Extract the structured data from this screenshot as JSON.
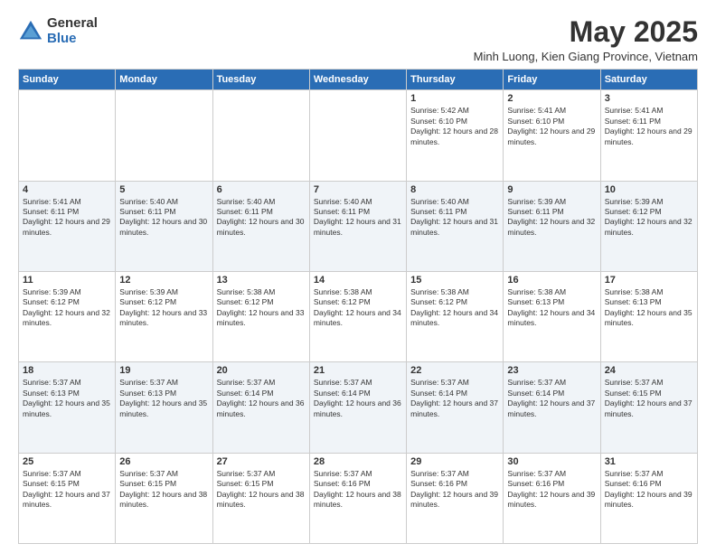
{
  "logo": {
    "general": "General",
    "blue": "Blue"
  },
  "header": {
    "month_title": "May 2025",
    "location": "Minh Luong, Kien Giang Province, Vietnam"
  },
  "days_of_week": [
    "Sunday",
    "Monday",
    "Tuesday",
    "Wednesday",
    "Thursday",
    "Friday",
    "Saturday"
  ],
  "weeks": [
    [
      {
        "day": "",
        "sunrise": "",
        "sunset": "",
        "daylight": ""
      },
      {
        "day": "",
        "sunrise": "",
        "sunset": "",
        "daylight": ""
      },
      {
        "day": "",
        "sunrise": "",
        "sunset": "",
        "daylight": ""
      },
      {
        "day": "",
        "sunrise": "",
        "sunset": "",
        "daylight": ""
      },
      {
        "day": "1",
        "sunrise": "Sunrise: 5:42 AM",
        "sunset": "Sunset: 6:10 PM",
        "daylight": "Daylight: 12 hours and 28 minutes."
      },
      {
        "day": "2",
        "sunrise": "Sunrise: 5:41 AM",
        "sunset": "Sunset: 6:10 PM",
        "daylight": "Daylight: 12 hours and 29 minutes."
      },
      {
        "day": "3",
        "sunrise": "Sunrise: 5:41 AM",
        "sunset": "Sunset: 6:11 PM",
        "daylight": "Daylight: 12 hours and 29 minutes."
      }
    ],
    [
      {
        "day": "4",
        "sunrise": "Sunrise: 5:41 AM",
        "sunset": "Sunset: 6:11 PM",
        "daylight": "Daylight: 12 hours and 29 minutes."
      },
      {
        "day": "5",
        "sunrise": "Sunrise: 5:40 AM",
        "sunset": "Sunset: 6:11 PM",
        "daylight": "Daylight: 12 hours and 30 minutes."
      },
      {
        "day": "6",
        "sunrise": "Sunrise: 5:40 AM",
        "sunset": "Sunset: 6:11 PM",
        "daylight": "Daylight: 12 hours and 30 minutes."
      },
      {
        "day": "7",
        "sunrise": "Sunrise: 5:40 AM",
        "sunset": "Sunset: 6:11 PM",
        "daylight": "Daylight: 12 hours and 31 minutes."
      },
      {
        "day": "8",
        "sunrise": "Sunrise: 5:40 AM",
        "sunset": "Sunset: 6:11 PM",
        "daylight": "Daylight: 12 hours and 31 minutes."
      },
      {
        "day": "9",
        "sunrise": "Sunrise: 5:39 AM",
        "sunset": "Sunset: 6:11 PM",
        "daylight": "Daylight: 12 hours and 32 minutes."
      },
      {
        "day": "10",
        "sunrise": "Sunrise: 5:39 AM",
        "sunset": "Sunset: 6:12 PM",
        "daylight": "Daylight: 12 hours and 32 minutes."
      }
    ],
    [
      {
        "day": "11",
        "sunrise": "Sunrise: 5:39 AM",
        "sunset": "Sunset: 6:12 PM",
        "daylight": "Daylight: 12 hours and 32 minutes."
      },
      {
        "day": "12",
        "sunrise": "Sunrise: 5:39 AM",
        "sunset": "Sunset: 6:12 PM",
        "daylight": "Daylight: 12 hours and 33 minutes."
      },
      {
        "day": "13",
        "sunrise": "Sunrise: 5:38 AM",
        "sunset": "Sunset: 6:12 PM",
        "daylight": "Daylight: 12 hours and 33 minutes."
      },
      {
        "day": "14",
        "sunrise": "Sunrise: 5:38 AM",
        "sunset": "Sunset: 6:12 PM",
        "daylight": "Daylight: 12 hours and 34 minutes."
      },
      {
        "day": "15",
        "sunrise": "Sunrise: 5:38 AM",
        "sunset": "Sunset: 6:12 PM",
        "daylight": "Daylight: 12 hours and 34 minutes."
      },
      {
        "day": "16",
        "sunrise": "Sunrise: 5:38 AM",
        "sunset": "Sunset: 6:13 PM",
        "daylight": "Daylight: 12 hours and 34 minutes."
      },
      {
        "day": "17",
        "sunrise": "Sunrise: 5:38 AM",
        "sunset": "Sunset: 6:13 PM",
        "daylight": "Daylight: 12 hours and 35 minutes."
      }
    ],
    [
      {
        "day": "18",
        "sunrise": "Sunrise: 5:37 AM",
        "sunset": "Sunset: 6:13 PM",
        "daylight": "Daylight: 12 hours and 35 minutes."
      },
      {
        "day": "19",
        "sunrise": "Sunrise: 5:37 AM",
        "sunset": "Sunset: 6:13 PM",
        "daylight": "Daylight: 12 hours and 35 minutes."
      },
      {
        "day": "20",
        "sunrise": "Sunrise: 5:37 AM",
        "sunset": "Sunset: 6:14 PM",
        "daylight": "Daylight: 12 hours and 36 minutes."
      },
      {
        "day": "21",
        "sunrise": "Sunrise: 5:37 AM",
        "sunset": "Sunset: 6:14 PM",
        "daylight": "Daylight: 12 hours and 36 minutes."
      },
      {
        "day": "22",
        "sunrise": "Sunrise: 5:37 AM",
        "sunset": "Sunset: 6:14 PM",
        "daylight": "Daylight: 12 hours and 37 minutes."
      },
      {
        "day": "23",
        "sunrise": "Sunrise: 5:37 AM",
        "sunset": "Sunset: 6:14 PM",
        "daylight": "Daylight: 12 hours and 37 minutes."
      },
      {
        "day": "24",
        "sunrise": "Sunrise: 5:37 AM",
        "sunset": "Sunset: 6:15 PM",
        "daylight": "Daylight: 12 hours and 37 minutes."
      }
    ],
    [
      {
        "day": "25",
        "sunrise": "Sunrise: 5:37 AM",
        "sunset": "Sunset: 6:15 PM",
        "daylight": "Daylight: 12 hours and 37 minutes."
      },
      {
        "day": "26",
        "sunrise": "Sunrise: 5:37 AM",
        "sunset": "Sunset: 6:15 PM",
        "daylight": "Daylight: 12 hours and 38 minutes."
      },
      {
        "day": "27",
        "sunrise": "Sunrise: 5:37 AM",
        "sunset": "Sunset: 6:15 PM",
        "daylight": "Daylight: 12 hours and 38 minutes."
      },
      {
        "day": "28",
        "sunrise": "Sunrise: 5:37 AM",
        "sunset": "Sunset: 6:16 PM",
        "daylight": "Daylight: 12 hours and 38 minutes."
      },
      {
        "day": "29",
        "sunrise": "Sunrise: 5:37 AM",
        "sunset": "Sunset: 6:16 PM",
        "daylight": "Daylight: 12 hours and 39 minutes."
      },
      {
        "day": "30",
        "sunrise": "Sunrise: 5:37 AM",
        "sunset": "Sunset: 6:16 PM",
        "daylight": "Daylight: 12 hours and 39 minutes."
      },
      {
        "day": "31",
        "sunrise": "Sunrise: 5:37 AM",
        "sunset": "Sunset: 6:16 PM",
        "daylight": "Daylight: 12 hours and 39 minutes."
      }
    ]
  ]
}
